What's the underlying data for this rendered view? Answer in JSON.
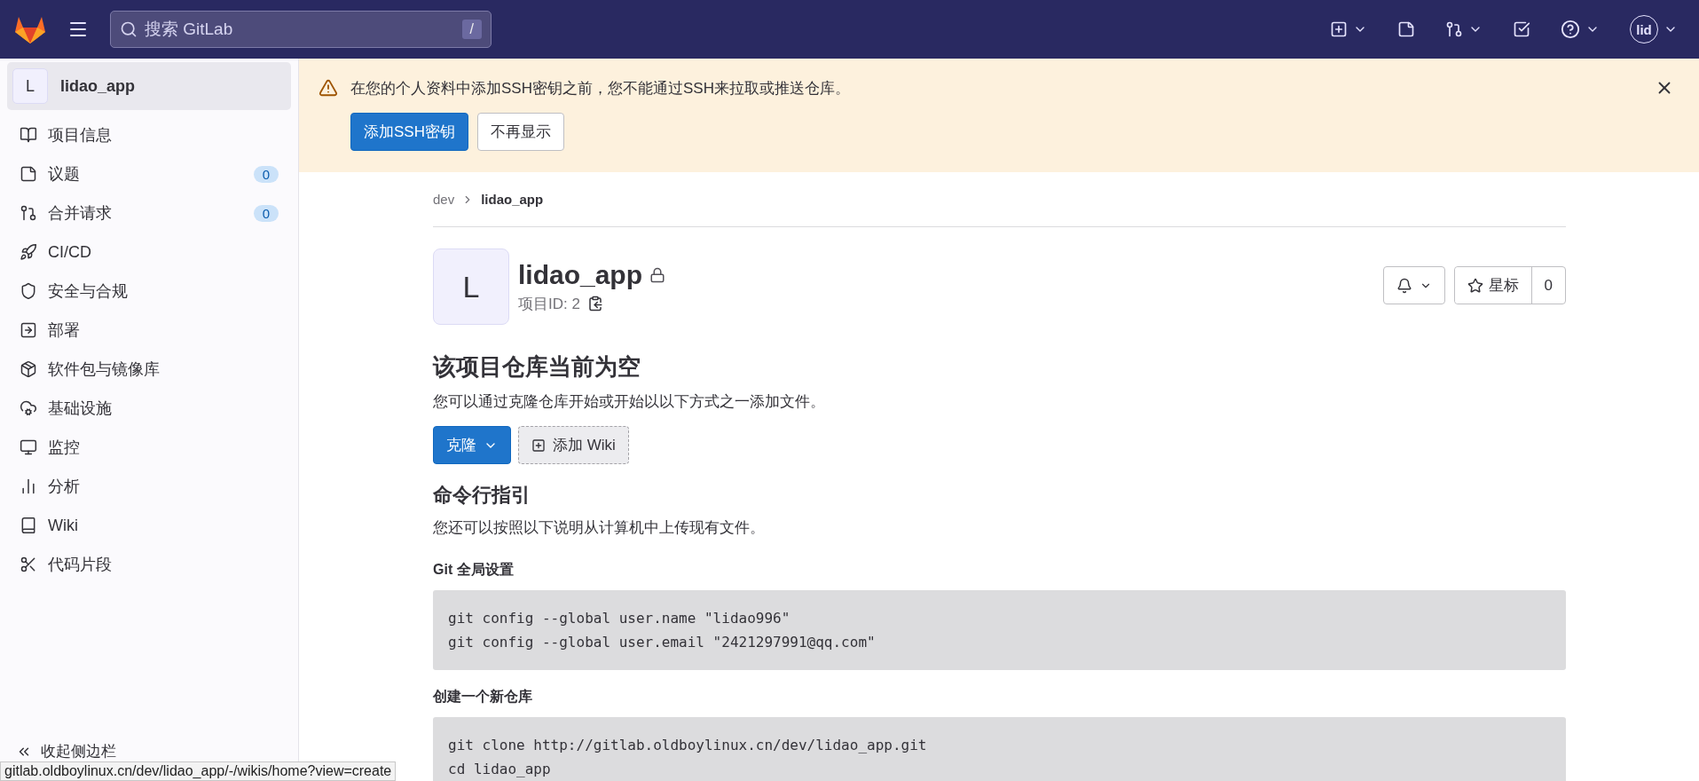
{
  "top_bar": {
    "search": {
      "placeholder": "搜索 GitLab",
      "shortcut": "/"
    },
    "avatar": "lid"
  },
  "sidebar": {
    "project": {
      "avatar": "L",
      "name": "lidao_app"
    },
    "items": [
      {
        "label": "项目信息"
      },
      {
        "label": "议题",
        "count": "0"
      },
      {
        "label": "合并请求",
        "count": "0"
      },
      {
        "label": "CI/CD"
      },
      {
        "label": "安全与合规"
      },
      {
        "label": "部署"
      },
      {
        "label": "软件包与镜像库"
      },
      {
        "label": "基础设施"
      },
      {
        "label": "监控"
      },
      {
        "label": "分析"
      },
      {
        "label": "Wiki"
      },
      {
        "label": "代码片段"
      }
    ],
    "collapse": "收起侧边栏"
  },
  "alert": {
    "message": "在您的个人资料中添加SSH密钥之前，您不能通过SSH来拉取或推送仓库。",
    "buttons": [
      "添加SSH密钥",
      "不再显示"
    ]
  },
  "breadcrumb": [
    "dev",
    "lidao_app"
  ],
  "project": {
    "avatar": "L",
    "name": "lidao_app",
    "id_label": "项目ID: 2",
    "star_label": "星标",
    "star_count": "0"
  },
  "empty": {
    "title": "该项目仓库当前为空",
    "description": "您可以通过克隆仓库开始或开始以以下方式之一添加文件。",
    "clone_button": "克隆",
    "wiki_button": "添加 Wiki"
  },
  "cli": {
    "title": "命令行指引",
    "description": "您还可以按照以下说明从计算机中上传现有文件。",
    "sections": [
      {
        "title": "Git 全局设置",
        "lines": [
          "git config --global user.name \"lidao996\"",
          "git config --global user.email \"2421297991@qq.com\""
        ]
      },
      {
        "title": "创建一个新仓库",
        "lines": [
          "git clone http://gitlab.oldboylinux.cn/dev/lidao_app.git",
          "cd lidao_app"
        ]
      }
    ]
  },
  "status_url": "gitlab.oldboylinux.cn/dev/lidao_app/-/wikis/home?view=create"
}
